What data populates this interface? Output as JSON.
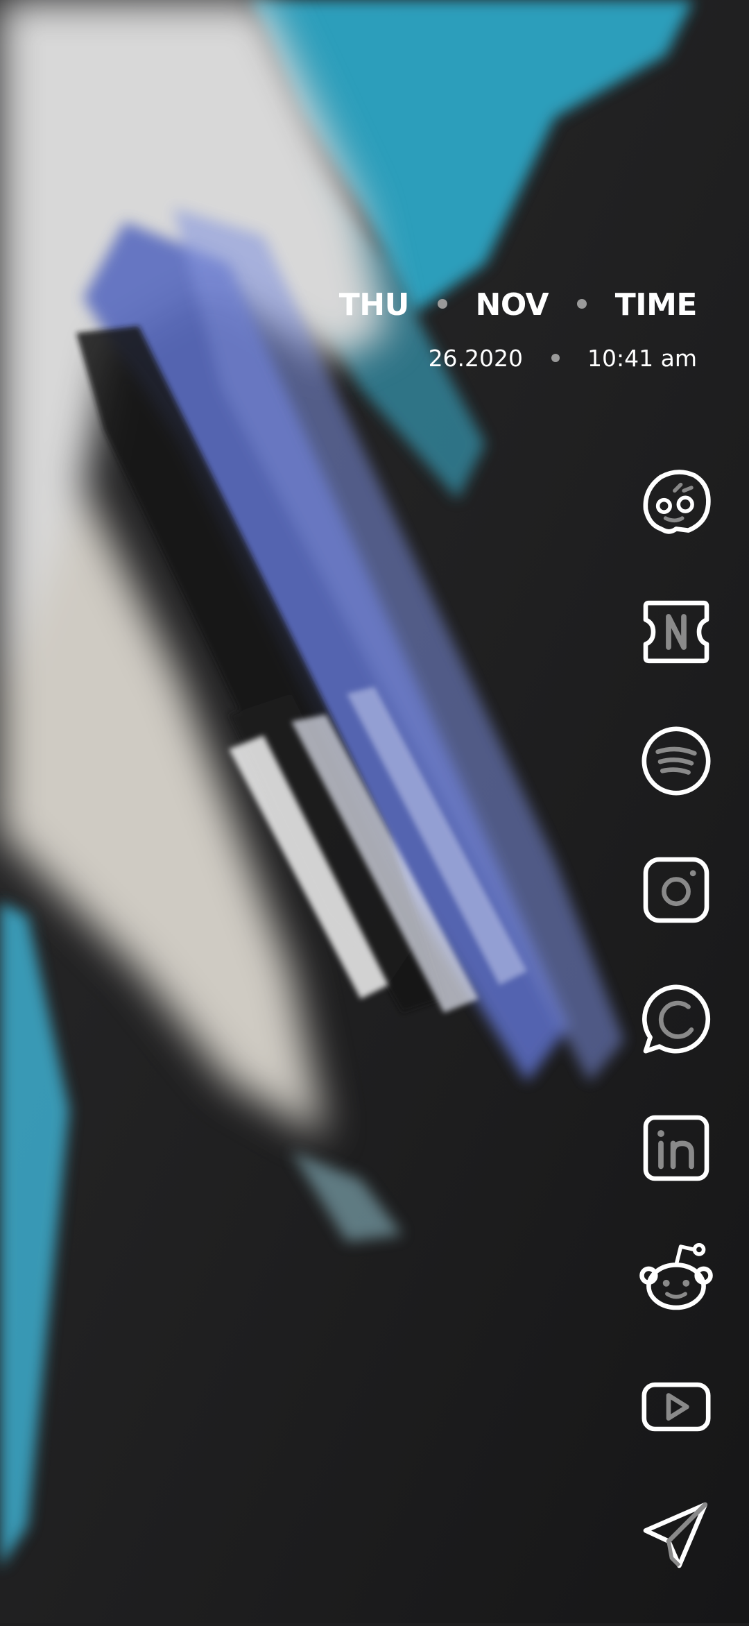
{
  "status": {
    "day": "THU",
    "month": "NOV",
    "time_label": "TIME",
    "date": "26.2020",
    "time": "10:41 am"
  },
  "apps": [
    {
      "icon": "faceapp-icon"
    },
    {
      "icon": "netflix-icon"
    },
    {
      "icon": "spotify-icon"
    },
    {
      "icon": "instagram-icon"
    },
    {
      "icon": "whatsapp-icon"
    },
    {
      "icon": "linkedin-icon"
    },
    {
      "icon": "reddit-icon"
    },
    {
      "icon": "youtube-icon"
    },
    {
      "icon": "telegram-icon"
    }
  ],
  "colors": {
    "background": "#1e1e1f",
    "accent_cyan": "#2fb4d6",
    "accent_blue": "#6a7ccc",
    "icon_stroke": "#ffffff"
  }
}
